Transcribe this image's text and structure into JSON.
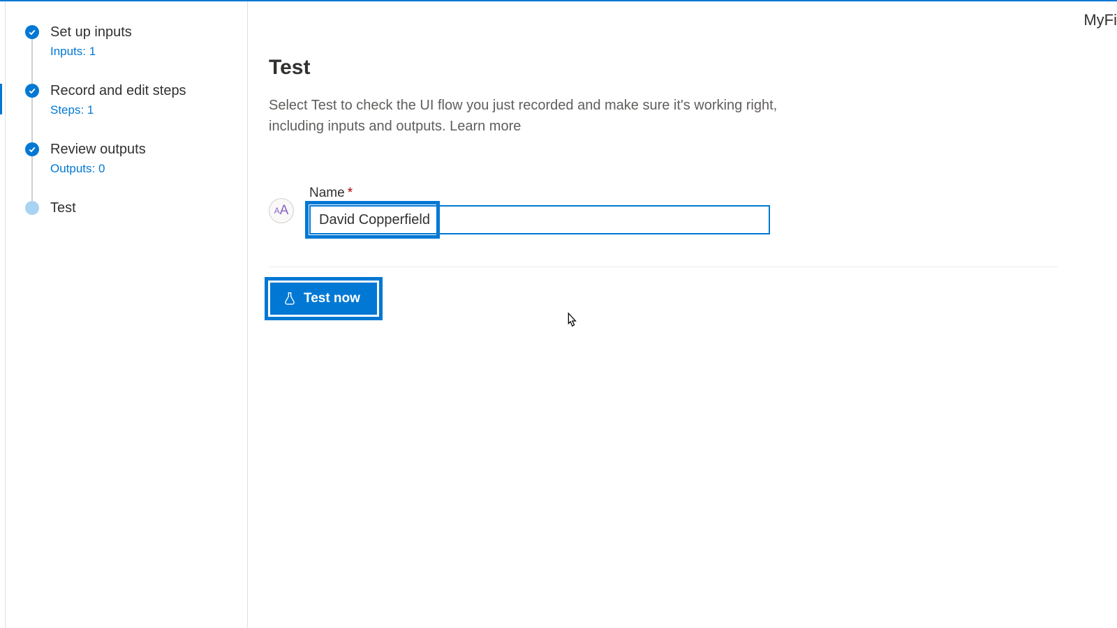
{
  "header": {
    "right_text": "MyFi"
  },
  "sidebar": {
    "steps": [
      {
        "title": "Set up inputs",
        "sub": "Inputs: 1",
        "done": true
      },
      {
        "title": "Record and edit steps",
        "sub": "Steps: 1",
        "done": true
      },
      {
        "title": "Review outputs",
        "sub": "Outputs: 0",
        "done": true
      },
      {
        "title": "Test",
        "sub": "",
        "done": false
      }
    ]
  },
  "main": {
    "title": "Test",
    "description": "Select Test to check the UI flow you just recorded and make sure it's working right, including inputs and outputs. ",
    "learn_more": "Learn more",
    "field": {
      "label": "Name",
      "required_mark": "*",
      "value": "David Copperfield",
      "icon_small": "A",
      "icon_big": "A"
    },
    "actions": {
      "test_now": "Test now"
    }
  }
}
